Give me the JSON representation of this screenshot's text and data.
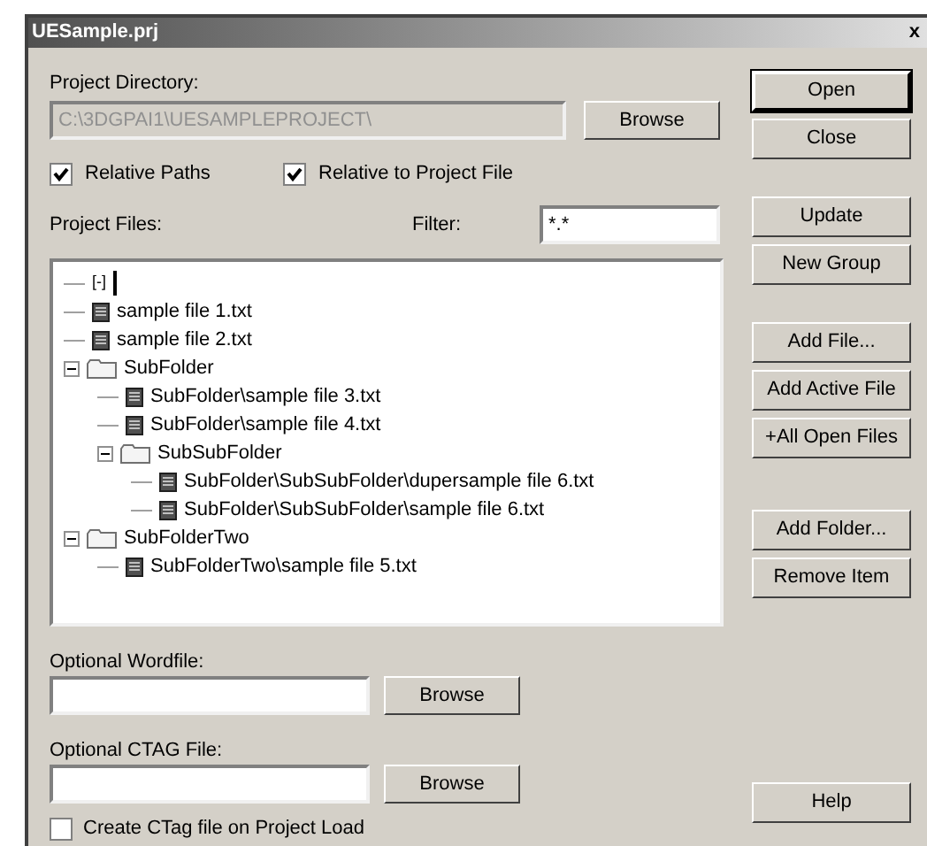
{
  "window": {
    "title": "UESample.prj",
    "close": "x"
  },
  "project_directory": {
    "label": "Project Directory:",
    "value": "C:\\3DGPAI1\\UESAMPLEPROJECT\\",
    "disabled": true,
    "browse": "Browse"
  },
  "options": [
    {
      "label": "Relative Paths",
      "checked": true
    },
    {
      "label": "Relative to Project File",
      "checked": true
    }
  ],
  "project_files": {
    "label": "Project Files:",
    "filter_label": "Filter:",
    "filter_value": "*.*"
  },
  "tree": [
    {
      "kind": "root",
      "label": "[-]",
      "editing": true
    },
    {
      "kind": "file",
      "label": "sample file 1.txt"
    },
    {
      "kind": "file",
      "label": "sample file 2.txt"
    },
    {
      "kind": "folder",
      "label": "SubFolder",
      "expanded": true,
      "children": [
        {
          "kind": "file",
          "label": "SubFolder\\sample file 3.txt"
        },
        {
          "kind": "file",
          "label": "SubFolder\\sample file 4.txt"
        },
        {
          "kind": "folder",
          "label": "SubSubFolder",
          "expanded": true,
          "children": [
            {
              "kind": "file",
              "label": "SubFolder\\SubSubFolder\\dupersample file 6.txt"
            },
            {
              "kind": "file",
              "label": "SubFolder\\SubSubFolder\\sample file 6.txt"
            }
          ]
        }
      ]
    },
    {
      "kind": "folder",
      "label": "SubFolderTwo",
      "expanded": true,
      "children": [
        {
          "kind": "file",
          "label": "SubFolderTwo\\sample file 5.txt"
        }
      ]
    }
  ],
  "wordfile": {
    "label": "Optional Wordfile:",
    "browse": "Browse"
  },
  "ctag_file": {
    "label": "Optional CTAG File:",
    "browse": "Browse"
  },
  "create_ctag": {
    "label": "Create CTag file on Project Load",
    "checked": false
  },
  "side_buttons": [
    {
      "label": "Open",
      "gap_before": false,
      "default": true
    },
    {
      "label": "Close",
      "gap_before": false,
      "default": false
    },
    {
      "label": "Update",
      "gap_before": true,
      "default": false
    },
    {
      "label": "New Group",
      "gap_before": false,
      "default": false
    },
    {
      "label": "Add File...",
      "gap_before": true,
      "default": false
    },
    {
      "label": "Add Active File",
      "gap_before": false,
      "default": false
    },
    {
      "label": "+All Open Files",
      "gap_before": false,
      "default": false
    },
    {
      "label": "Add Folder...",
      "gap_before": true,
      "default": false
    },
    {
      "label": "Remove Item",
      "gap_before": false,
      "default": false
    },
    {
      "label": "Help",
      "gap_before": true,
      "default": false
    }
  ]
}
